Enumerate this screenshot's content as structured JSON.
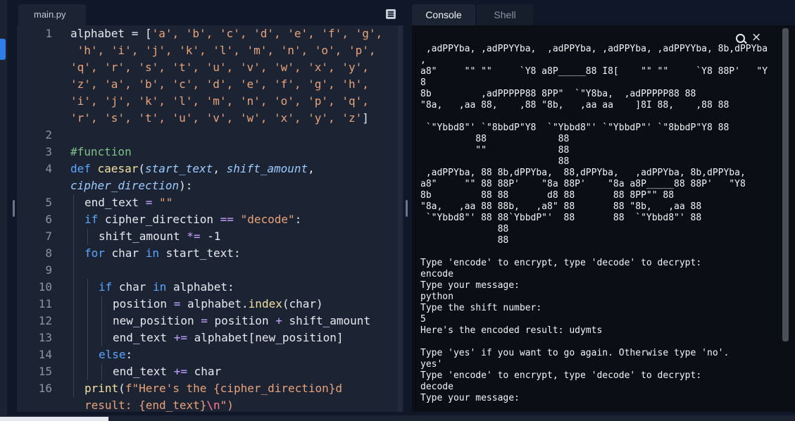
{
  "editor": {
    "file_tab": "main.py",
    "line_numbers": [
      "1",
      "",
      "",
      "",
      "",
      "",
      "2",
      "3",
      "4",
      "",
      "5",
      "6",
      "7",
      "8",
      "9",
      "10",
      "11",
      "12",
      "13",
      "14",
      "15",
      "16",
      ""
    ]
  },
  "code": {
    "l1_a": "alphabet = [",
    "l1_b": "'a', 'b', 'c', 'd', 'e', 'f', 'g',",
    "l1c2": " 'h', 'i', 'j', 'k', 'l', 'm', 'n', 'o', 'p',",
    "l1c3": "'q', 'r', 's', 't', 'u', 'v', 'w', 'x', 'y',",
    "l1c4": "'z', 'a', 'b', 'c', 'd', 'e', 'f', 'g', 'h',",
    "l1c5": "'i', 'j', 'k', 'l', 'm', 'n', 'o', 'p', 'q',",
    "l1c6": "'r', 's', 't', 'u', 'v', 'w', 'x', 'y', 'z'",
    "l1c6_end": "]",
    "l3": "#function",
    "l4_def": "def",
    "l4_name": " caesar",
    "l4_p1": "(",
    "l4_a1": "start_text",
    "l4_p2": ", ",
    "l4_a2": "shift_amount",
    "l4_p3": ",",
    "l4c_a3": "cipher_direction",
    "l4c_end": "):",
    "l5_a": "end_text ",
    "l5_op": "=",
    "l5_s": " \"\"",
    "l6_kw": "if",
    "l6_a": " cipher_direction ",
    "l6_op": "==",
    "l6_s": " \"decode\"",
    "l6_end": ":",
    "l7_a": "shift_amount ",
    "l7_op": "*=",
    "l7_b": " -1",
    "l8_kw": "for",
    "l8_a": " char ",
    "l8_kw2": "in",
    "l8_b": " start_text",
    "l8_end": ":",
    "l10_kw": "if",
    "l10_a": " char ",
    "l10_kw2": "in",
    "l10_b": " alphabet",
    "l10_end": ":",
    "l11_a": "position ",
    "l11_op": "=",
    "l11_b": " alphabet.",
    "l11_f": "index",
    "l11_c": "(char)",
    "l12_a": "new_position ",
    "l12_op": "=",
    "l12_b": " position ",
    "l12_op2": "+",
    "l12_c": " shift_amount",
    "l13_a": "end_text ",
    "l13_op": "+=",
    "l13_b": " alphabet[new_position]",
    "l14_kw": "else",
    "l14_end": ":",
    "l15_a": "end_text ",
    "l15_op": "+=",
    "l15_b": " char",
    "l16_f": "print",
    "l16_p": "(",
    "l16_s": "f\"Here's the {cipher_direction}d",
    "l16c_s": "result: {end_text}",
    "l16c_esc": "\\n",
    "l16c_end": "\")"
  },
  "console": {
    "tab_console": "Console",
    "tab_shell": "Shell",
    "output": " ,adPPYba, ,adPPYYba,  ,adPPYba, ,adPPYba, ,adPPYYba, 8b,dPPYba\n,\na8\"     \"\" \"\"     `Y8 a8P_____88 I8[    \"\" \"\"     `Y8 88P'   \"Y\n8\n8b         ,adPPPPP88 8PP\"  `\"Y8ba,  ,adPPPPP88 88\n\"8a,   ,aa 88,    ,88 \"8b,   ,aa aa    ]8I 88,    ,88 88\n\n `\"Ybbd8\"' `\"8bbdP\"Y8  `\"Ybbd8\"' `\"YbbdP\"' `\"8bbdP\"Y8 88\n          88             88\n          \"\"             88\n                         88\n ,adPPYba, 88 8b,dPPYba,  88,dPPYba,   ,adPPYba, 8b,dPPYba,\na8\"     \"\" 88 88P'    \"8a 88P'    \"8a a8P_____88 88P'   \"Y8\n8b         88 88       d8 88       88 8PP\"\" 88\n\"8a,   ,aa 88 88b,   ,a8\" 88       88 \"8b,   ,aa 88\n `\"Ybbd8\"' 88 88`YbbdP\"'  88       88  `\"Ybbd8\"' 88\n              88\n              88\n\nType 'encode' to encrypt, type 'decode' to decrypt:\nencode\nType your message:\npython\nType the shift number:\n5\nHere's the encoded result: udymts\n\nType 'yes' if you want to go again. Otherwise type 'no'.\nyes'\nType 'encode' to encrypt, type 'decode' to decrypt:\ndecode\nType your message:"
  },
  "colors": {
    "background": "#0f1729",
    "editor_bg": "#1c2333",
    "console_bg": "#0b0e14",
    "string": "#e9a37a",
    "keyword": "#5aa6ff",
    "comment": "#7ec18a"
  },
  "icons": [
    "menu-icon",
    "search-icon",
    "close-icon"
  ]
}
